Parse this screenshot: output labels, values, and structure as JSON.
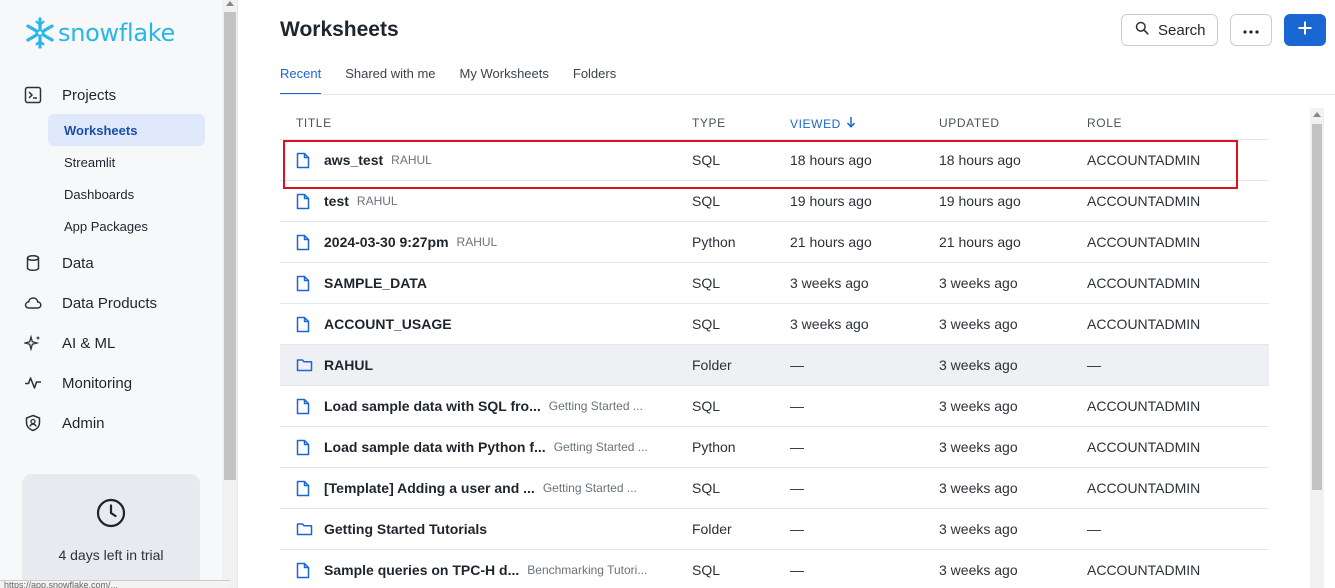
{
  "brand": {
    "logo_text": "snowflake"
  },
  "sidebar": {
    "nav": [
      {
        "label": "Projects",
        "icon": "terminal-icon"
      },
      {
        "label": "Data",
        "icon": "database-icon"
      },
      {
        "label": "Data Products",
        "icon": "cloud-icon"
      },
      {
        "label": "AI & ML",
        "icon": "sparkle-icon"
      },
      {
        "label": "Monitoring",
        "icon": "activity-icon"
      },
      {
        "label": "Admin",
        "icon": "shield-icon"
      }
    ],
    "sub_items": [
      {
        "label": "Worksheets",
        "active": true
      },
      {
        "label": "Streamlit"
      },
      {
        "label": "Dashboards"
      },
      {
        "label": "App Packages"
      }
    ],
    "trial_text": "4 days left in trial"
  },
  "status_bar_text": "https://app.snowflake.com/...",
  "header": {
    "title": "Worksheets",
    "search_label": "Search"
  },
  "tabs": [
    {
      "label": "Recent",
      "active": true
    },
    {
      "label": "Shared with me"
    },
    {
      "label": "My Worksheets"
    },
    {
      "label": "Folders"
    }
  ],
  "table": {
    "columns": {
      "title": "TITLE",
      "type": "TYPE",
      "viewed": "VIEWED",
      "updated": "UPDATED",
      "role": "ROLE"
    },
    "rows": [
      {
        "icon": "file-icon",
        "title": "aws_test",
        "owner": "RAHUL",
        "type": "SQL",
        "viewed": "18 hours ago",
        "updated": "18 hours ago",
        "role": "ACCOUNTADMIN"
      },
      {
        "icon": "file-icon",
        "title": "test",
        "owner": "RAHUL",
        "type": "SQL",
        "viewed": "19 hours ago",
        "updated": "19 hours ago",
        "role": "ACCOUNTADMIN"
      },
      {
        "icon": "file-icon",
        "title": "2024-03-30 9:27pm",
        "owner": "RAHUL",
        "type": "Python",
        "viewed": "21 hours ago",
        "updated": "21 hours ago",
        "role": "ACCOUNTADMIN"
      },
      {
        "icon": "file-icon",
        "title": "SAMPLE_DATA",
        "owner": "",
        "type": "SQL",
        "viewed": "3 weeks ago",
        "updated": "3 weeks ago",
        "role": "ACCOUNTADMIN"
      },
      {
        "icon": "file-icon",
        "title": "ACCOUNT_USAGE",
        "owner": "",
        "type": "SQL",
        "viewed": "3 weeks ago",
        "updated": "3 weeks ago",
        "role": "ACCOUNTADMIN"
      },
      {
        "icon": "folder-icon",
        "title": "RAHUL",
        "owner": "",
        "type": "Folder",
        "viewed": "—",
        "updated": "3 weeks ago",
        "role": "—"
      },
      {
        "icon": "file-icon",
        "title": "Load sample data with SQL fro...",
        "owner": "Getting Started ...",
        "type": "SQL",
        "viewed": "—",
        "updated": "3 weeks ago",
        "role": "ACCOUNTADMIN"
      },
      {
        "icon": "file-icon",
        "title": "Load sample data with Python f...",
        "owner": "Getting Started ...",
        "type": "Python",
        "viewed": "—",
        "updated": "3 weeks ago",
        "role": "ACCOUNTADMIN"
      },
      {
        "icon": "file-icon",
        "title": "[Template] Adding a user and ...",
        "owner": "Getting Started ...",
        "type": "SQL",
        "viewed": "—",
        "updated": "3 weeks ago",
        "role": "ACCOUNTADMIN"
      },
      {
        "icon": "folder-icon",
        "title": "Getting Started Tutorials",
        "owner": "",
        "type": "Folder",
        "viewed": "—",
        "updated": "3 weeks ago",
        "role": "—"
      },
      {
        "icon": "file-icon",
        "title": "Sample queries on TPC-H d...",
        "owner": "Benchmarking Tutori...",
        "type": "SQL",
        "viewed": "—",
        "updated": "3 weeks ago",
        "role": "ACCOUNTADMIN"
      }
    ]
  },
  "colors": {
    "brand": "#29b5e8",
    "accent": "#1a66d2",
    "highlight": "#d8121e"
  }
}
